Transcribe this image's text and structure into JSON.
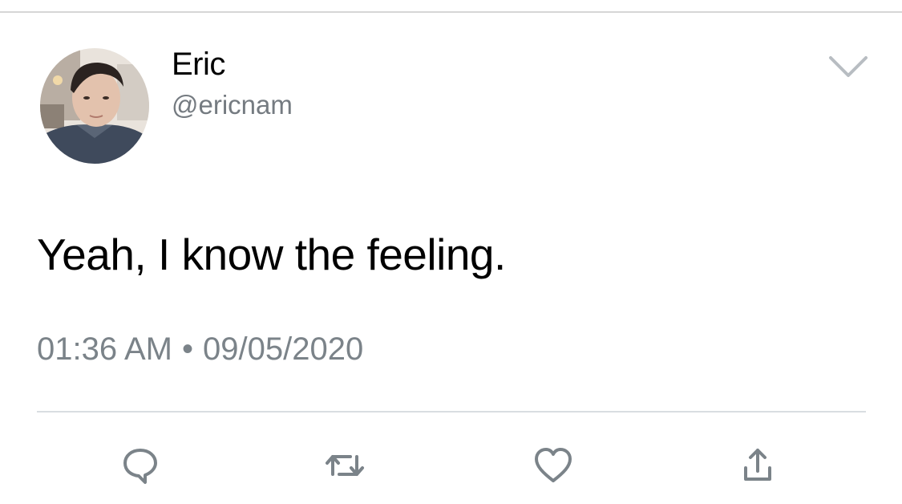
{
  "tweet": {
    "author": {
      "display_name": "Eric",
      "handle": "@ericnam"
    },
    "text": "Yeah, I know the feeling.",
    "time": "01:36 AM",
    "separator": "•",
    "date": "09/05/2020"
  },
  "colors": {
    "text_primary": "#000000",
    "text_secondary": "#757b81",
    "icon_gray": "#7b8389",
    "divider": "#d9dde1"
  },
  "icons": {
    "menu": "chevron-down-icon",
    "reply": "reply-icon",
    "retweet": "retweet-icon",
    "like": "heart-icon",
    "share": "share-icon"
  }
}
